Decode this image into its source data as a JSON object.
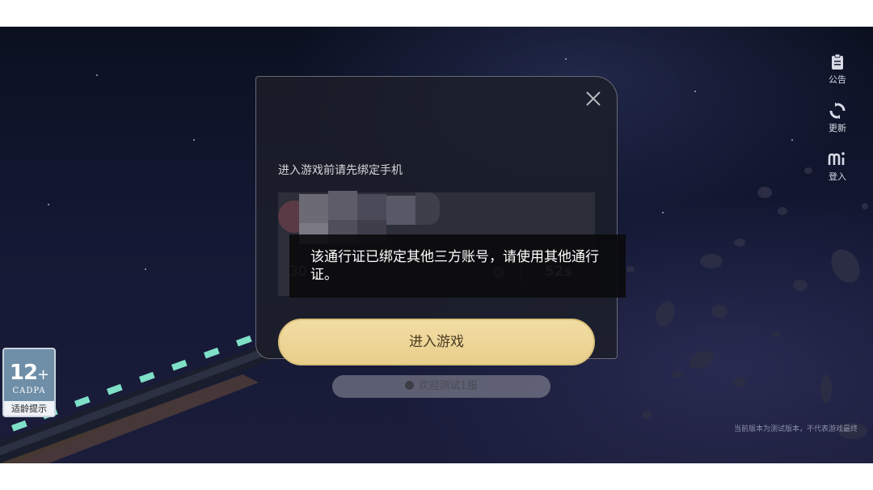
{
  "sidebar": {
    "announcement_label": "公告",
    "update_label": "更新",
    "login_label": "登入"
  },
  "age_rating": {
    "age": "12",
    "plus": "+",
    "org": "CADPA",
    "tip": "适龄提示"
  },
  "version_note": "当前版本为测试版本，不代表游戏最终",
  "dialog": {
    "title": "进入游戏前请先绑定手机",
    "phone_prefix": "30",
    "clear_symbol": "×",
    "countdown": "52s",
    "enter_button": "进入游戏",
    "server_label": "欢迎测试1服"
  },
  "toast": {
    "message": "该通行证已绑定其他三方账号，请使用其他通行证。"
  },
  "colors": {
    "button_gold": "#f1dca4",
    "dialog_bg": "#1c1e28",
    "toast_bg": "#0a0a0c"
  }
}
